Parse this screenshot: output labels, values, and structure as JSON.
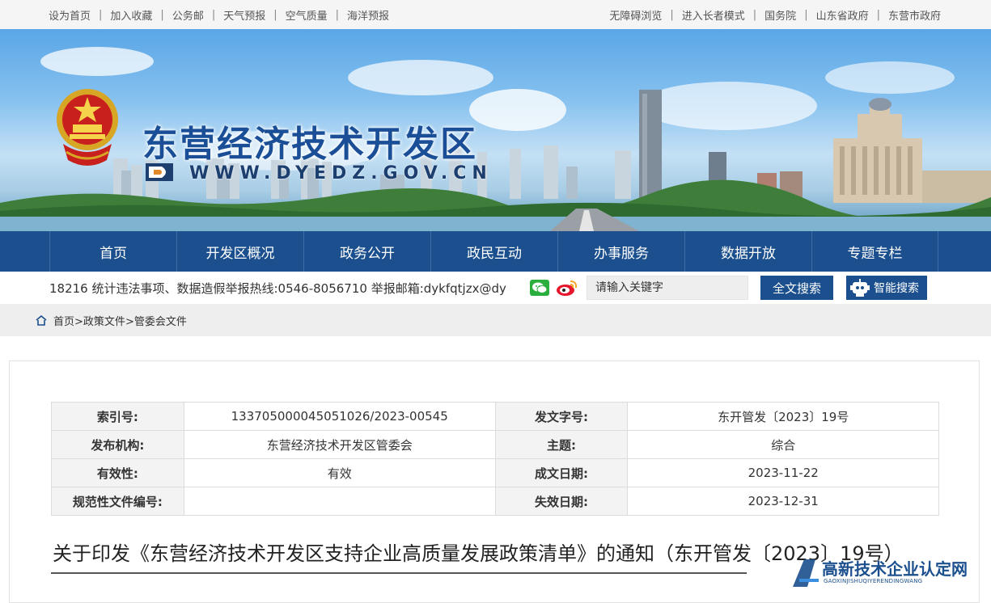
{
  "topbar": {
    "left": [
      "设为首页",
      "加入收藏",
      "公务邮",
      "天气预报",
      "空气质量",
      "海洋预报"
    ],
    "right": [
      "无障碍浏览",
      "进入长者模式",
      "国务院",
      "山东省政府",
      "东营市政府"
    ]
  },
  "banner": {
    "title": "东营经济技术开发区",
    "url": "WWW.DYEDZ.GOV.CN"
  },
  "nav": [
    "首页",
    "开发区概况",
    "政务公开",
    "政民互动",
    "办事服务",
    "数据开放",
    "专题专栏"
  ],
  "search": {
    "ticker": "18216 统计违法事项、数据造假举报热线:0546-8056710 举报邮箱:dykfqtjzx@dy",
    "placeholder": "请输入关键字",
    "fulltext_label": "全文搜索",
    "smart_label": "智能搜索"
  },
  "breadcrumb": [
    "首页",
    "政策文件",
    "管委会文件"
  ],
  "meta_table": [
    [
      "索引号:",
      "13370500004505102­6/2023-00545",
      "发文字号:",
      "东开管发〔2023〕19号"
    ],
    [
      "发布机构:",
      "东营经济技术开发区管委会",
      "主题:",
      "综合"
    ],
    [
      "有效性:",
      "有效",
      "成文日期:",
      "2023-11-22"
    ],
    [
      "规范性文件编号:",
      "",
      "失效日期:",
      "2023-12-31"
    ]
  ],
  "document_title": "关于印发《东营经济技术开发区支持企业高质量发展政策清单》的通知（东开管发〔2023〕19号）",
  "watermark": {
    "text": "高新技术企业认定网",
    "sub": "GAOXINJISHUQIYERENDINGWANG"
  },
  "colors": {
    "nav_blue": "#1b4f8d",
    "title_blue": "#1a4e97"
  }
}
